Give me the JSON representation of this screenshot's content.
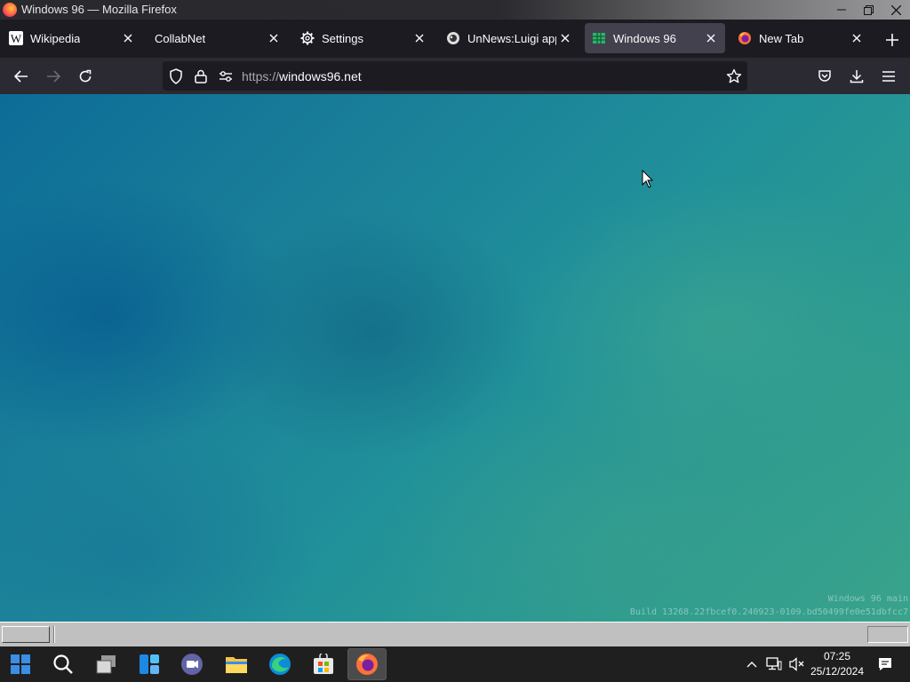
{
  "window": {
    "title": "Windows 96 — Mozilla Firefox"
  },
  "tabs": [
    {
      "label": "Wikipedia",
      "icon": "wikipedia-icon",
      "active": false
    },
    {
      "label": "CollabNet",
      "icon": "",
      "active": false
    },
    {
      "label": "Settings",
      "icon": "gear-icon",
      "active": false
    },
    {
      "label": "UnNews:Luigi appre",
      "icon": "uncyclopedia-icon",
      "active": false
    },
    {
      "label": "Windows 96",
      "icon": "windows96-icon",
      "active": true
    },
    {
      "label": "New Tab",
      "icon": "firefox-icon",
      "active": false
    }
  ],
  "urlbar": {
    "protocol": "https://",
    "host": "windows96.net"
  },
  "page": {
    "build_line1": "Windows 96 main",
    "build_line2": "Build 13268.22fbcef0.240923-0109.bd50499fe0e51dbfcc7"
  },
  "taskbar": {
    "time": "07:25",
    "date": "25/12/2024",
    "active_app": "firefox-icon"
  },
  "colors": {
    "firefox_chrome": "#1c1b22",
    "navbar": "#2b2a33",
    "active_tab": "#42414d",
    "desktop_teal": "#21919a"
  }
}
